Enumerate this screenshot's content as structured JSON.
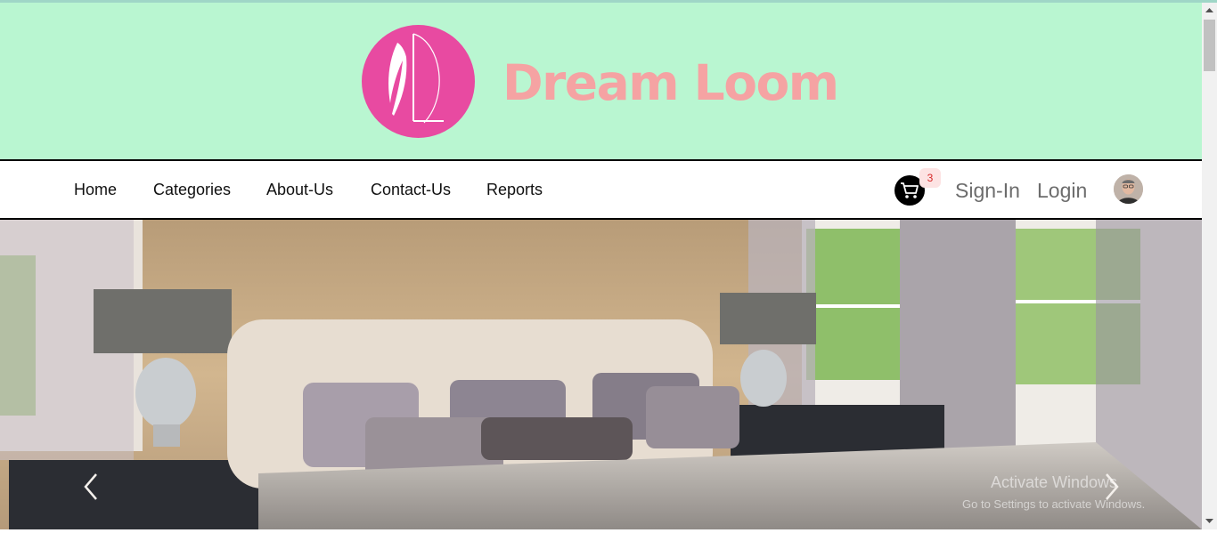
{
  "brand": {
    "name": "Dream Loom",
    "logo_icon": "feather-l-logo"
  },
  "nav": {
    "items": [
      {
        "label": "Home"
      },
      {
        "label": "Categories"
      },
      {
        "label": "About-Us"
      },
      {
        "label": "Contact-Us"
      },
      {
        "label": "Reports"
      }
    ]
  },
  "cart": {
    "icon": "cart-icon",
    "count": "3"
  },
  "auth": {
    "signin_label": "Sign-In",
    "login_label": "Login"
  },
  "user": {
    "avatar_icon": "user-avatar"
  },
  "hero": {
    "image_subject": "bedroom-photo",
    "prev_icon": "chevron-left-icon",
    "next_icon": "chevron-right-icon",
    "watermark_title": "Activate Windows",
    "watermark_sub": "Go to Settings to activate Windows."
  },
  "colors": {
    "header_bg": "#b9f6d1",
    "logo_circle": "#e84aa1",
    "brand_text": "#f5a3a3",
    "cart_badge_bg": "#fde3e3",
    "cart_badge_text": "#d62828"
  }
}
